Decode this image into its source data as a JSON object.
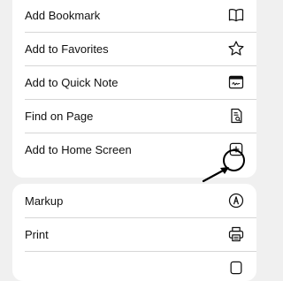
{
  "menu_group_1": {
    "items": [
      {
        "label": "Add Bookmark",
        "icon": "book-icon"
      },
      {
        "label": "Add to Favorites",
        "icon": "star-icon"
      },
      {
        "label": "Add to Quick Note",
        "icon": "quick-note-icon"
      },
      {
        "label": "Find on Page",
        "icon": "find-document-icon"
      },
      {
        "label": "Add to Home Screen",
        "icon": "plus-square-icon"
      }
    ]
  },
  "menu_group_2": {
    "items": [
      {
        "label": "Markup",
        "icon": "markup-pen-icon"
      },
      {
        "label": "Print",
        "icon": "printer-icon"
      }
    ]
  },
  "colors": {
    "background": "#f0f0f0",
    "card": "#ffffff",
    "text": "#111111",
    "divider": "#d6d6d6",
    "annotation": "#000000"
  }
}
